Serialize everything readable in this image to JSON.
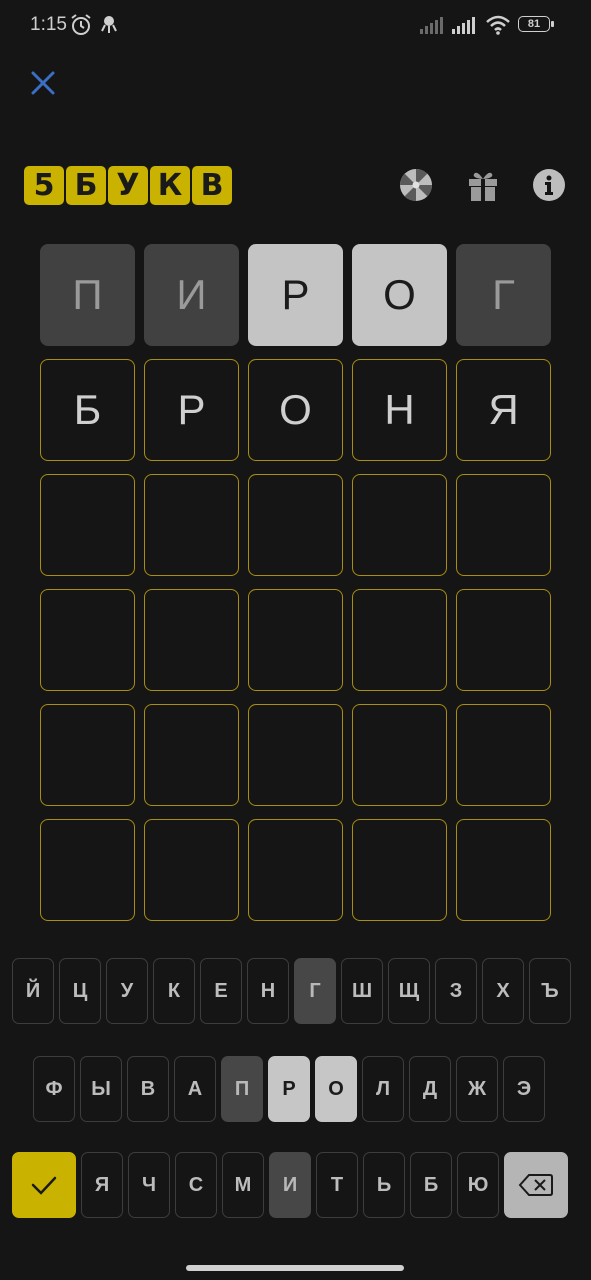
{
  "status": {
    "time": "1:15",
    "battery": "81"
  },
  "logo": [
    "5",
    "Б",
    "У",
    "К",
    "В"
  ],
  "board": [
    [
      {
        "l": "П",
        "s": "absent"
      },
      {
        "l": "И",
        "s": "absent"
      },
      {
        "l": "Р",
        "s": "present"
      },
      {
        "l": "О",
        "s": "present"
      },
      {
        "l": "Г",
        "s": "absent"
      }
    ],
    [
      {
        "l": "Б",
        "s": "typed"
      },
      {
        "l": "Р",
        "s": "typed"
      },
      {
        "l": "О",
        "s": "typed"
      },
      {
        "l": "Н",
        "s": "typed"
      },
      {
        "l": "Я",
        "s": "typed"
      }
    ],
    [
      {
        "l": "",
        "s": "empty"
      },
      {
        "l": "",
        "s": "empty"
      },
      {
        "l": "",
        "s": "empty"
      },
      {
        "l": "",
        "s": "empty"
      },
      {
        "l": "",
        "s": "empty"
      }
    ],
    [
      {
        "l": "",
        "s": "empty"
      },
      {
        "l": "",
        "s": "empty"
      },
      {
        "l": "",
        "s": "empty"
      },
      {
        "l": "",
        "s": "empty"
      },
      {
        "l": "",
        "s": "empty"
      }
    ],
    [
      {
        "l": "",
        "s": "empty"
      },
      {
        "l": "",
        "s": "empty"
      },
      {
        "l": "",
        "s": "empty"
      },
      {
        "l": "",
        "s": "empty"
      },
      {
        "l": "",
        "s": "empty"
      }
    ],
    [
      {
        "l": "",
        "s": "empty"
      },
      {
        "l": "",
        "s": "empty"
      },
      {
        "l": "",
        "s": "empty"
      },
      {
        "l": "",
        "s": "empty"
      },
      {
        "l": "",
        "s": "empty"
      }
    ]
  ],
  "keyboard": {
    "row1": [
      {
        "l": "Й",
        "s": ""
      },
      {
        "l": "Ц",
        "s": ""
      },
      {
        "l": "У",
        "s": ""
      },
      {
        "l": "К",
        "s": ""
      },
      {
        "l": "Е",
        "s": ""
      },
      {
        "l": "Н",
        "s": ""
      },
      {
        "l": "Г",
        "s": "absent"
      },
      {
        "l": "Ш",
        "s": ""
      },
      {
        "l": "Щ",
        "s": ""
      },
      {
        "l": "З",
        "s": ""
      },
      {
        "l": "Х",
        "s": ""
      },
      {
        "l": "Ъ",
        "s": ""
      }
    ],
    "row2": [
      {
        "l": "Ф",
        "s": ""
      },
      {
        "l": "Ы",
        "s": ""
      },
      {
        "l": "В",
        "s": ""
      },
      {
        "l": "А",
        "s": ""
      },
      {
        "l": "П",
        "s": "absent"
      },
      {
        "l": "Р",
        "s": "present"
      },
      {
        "l": "О",
        "s": "present"
      },
      {
        "l": "Л",
        "s": ""
      },
      {
        "l": "Д",
        "s": ""
      },
      {
        "l": "Ж",
        "s": ""
      },
      {
        "l": "Э",
        "s": ""
      }
    ],
    "row3": [
      {
        "l": "Я",
        "s": ""
      },
      {
        "l": "Ч",
        "s": ""
      },
      {
        "l": "С",
        "s": ""
      },
      {
        "l": "М",
        "s": ""
      },
      {
        "l": "И",
        "s": "absent"
      },
      {
        "l": "Т",
        "s": ""
      },
      {
        "l": "Ь",
        "s": ""
      },
      {
        "l": "Б",
        "s": ""
      },
      {
        "l": "Ю",
        "s": ""
      }
    ]
  },
  "icons": {
    "close": "close-icon",
    "wheel": "wheel-icon",
    "gift": "gift-icon",
    "info": "info-icon",
    "enter": "checkmark-icon",
    "backspace": "backspace-icon"
  },
  "colors": {
    "accent": "#c9b200",
    "absent": "#414141",
    "present": "#c4c4c4",
    "background": "#151515",
    "close": "#3a6fc4"
  }
}
